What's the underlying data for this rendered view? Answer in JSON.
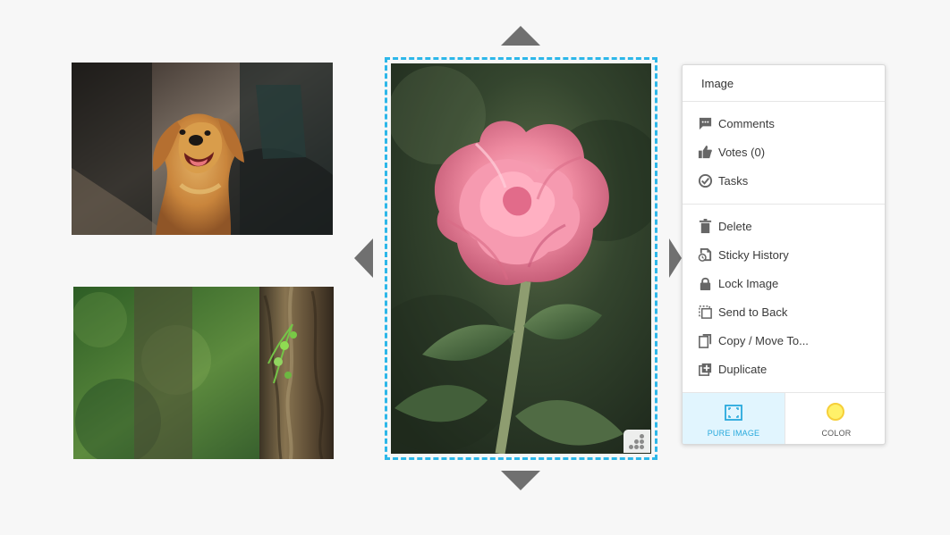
{
  "canvas": {
    "background_color": "#f7f7f7",
    "images": [
      {
        "name": "golden-retriever-photo",
        "icon": "dog-image",
        "colors": {
          "fur": "#c9853c",
          "background": "#3e3530"
        }
      },
      {
        "name": "forest-tree-photo",
        "icon": "forest-image",
        "colors": {
          "green": "#3f6b2d",
          "bark": "#6c5a3b"
        }
      },
      {
        "name": "pink-rose-photo",
        "icon": "rose-image",
        "selected": true,
        "selection_color": "#2db7e9",
        "colors": {
          "petal": "#ee8aa0",
          "leaf": "#4f6d45",
          "background": "#34452e"
        }
      }
    ],
    "navigation_arrows": [
      {
        "name": "move-up-arrow",
        "icon": "triangle-up-icon"
      },
      {
        "name": "move-down-arrow",
        "icon": "triangle-down-icon"
      },
      {
        "name": "move-left-arrow",
        "icon": "triangle-left-icon"
      },
      {
        "name": "move-right-arrow",
        "icon": "triangle-right-icon"
      }
    ]
  },
  "context_menu": {
    "title": "Image",
    "groups": [
      [
        {
          "label": "Comments",
          "icon": "comment-icon"
        },
        {
          "label": "Votes (0)",
          "icon": "thumbs-up-icon"
        },
        {
          "label": "Tasks",
          "icon": "check-circle-icon"
        }
      ],
      [
        {
          "label": "Delete",
          "icon": "trash-icon"
        },
        {
          "label": "Sticky History",
          "icon": "history-icon"
        },
        {
          "label": "Lock Image",
          "icon": "lock-icon"
        },
        {
          "label": "Send to Back",
          "icon": "send-to-back-icon"
        },
        {
          "label": "Copy / Move To...",
          "icon": "copy-move-icon"
        },
        {
          "label": "Duplicate",
          "icon": "duplicate-icon"
        }
      ]
    ],
    "options": [
      {
        "label": "PURE IMAGE",
        "icon": "pure-image-icon",
        "active": true,
        "accent": "#27a9dc",
        "background": "#e1f5fe"
      },
      {
        "label": "COLOR",
        "icon": "color-swatch-icon",
        "active": false,
        "swatch": "#fff169",
        "swatch_border": "#f6cf39"
      }
    ]
  }
}
